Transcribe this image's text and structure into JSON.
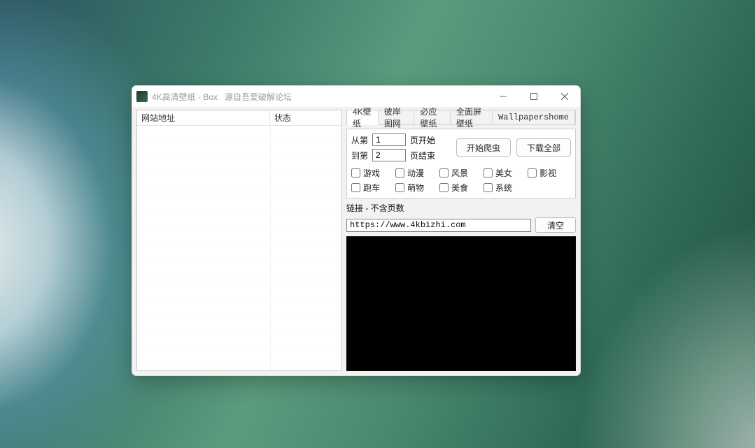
{
  "window": {
    "title": "4K高清壁纸 - Box   源自吾爱破解论坛"
  },
  "left": {
    "col_addr": "网站地址",
    "col_state": "状态"
  },
  "tabs": [
    {
      "label": "4K壁纸",
      "active": true
    },
    {
      "label": "彼岸图网"
    },
    {
      "label": "必应壁纸"
    },
    {
      "label": "全面屏壁纸"
    },
    {
      "label": "Wallpapershome",
      "mono": true
    }
  ],
  "range": {
    "fromLabel": "从第",
    "fromValue": "1",
    "fromSuffix": "页开始",
    "toLabel": "到第",
    "toValue": "2",
    "toSuffix": "页结束"
  },
  "buttons": {
    "startCrawl": "开始爬虫",
    "downloadAll": "下载全部",
    "clear": "清空"
  },
  "categories": [
    "游戏",
    "动漫",
    "风景",
    "美女",
    "影视",
    "跑车",
    "萌物",
    "美食",
    "系统"
  ],
  "link": {
    "label": "链接 - 不含页数",
    "value": "https://www.4kbizhi.com"
  }
}
